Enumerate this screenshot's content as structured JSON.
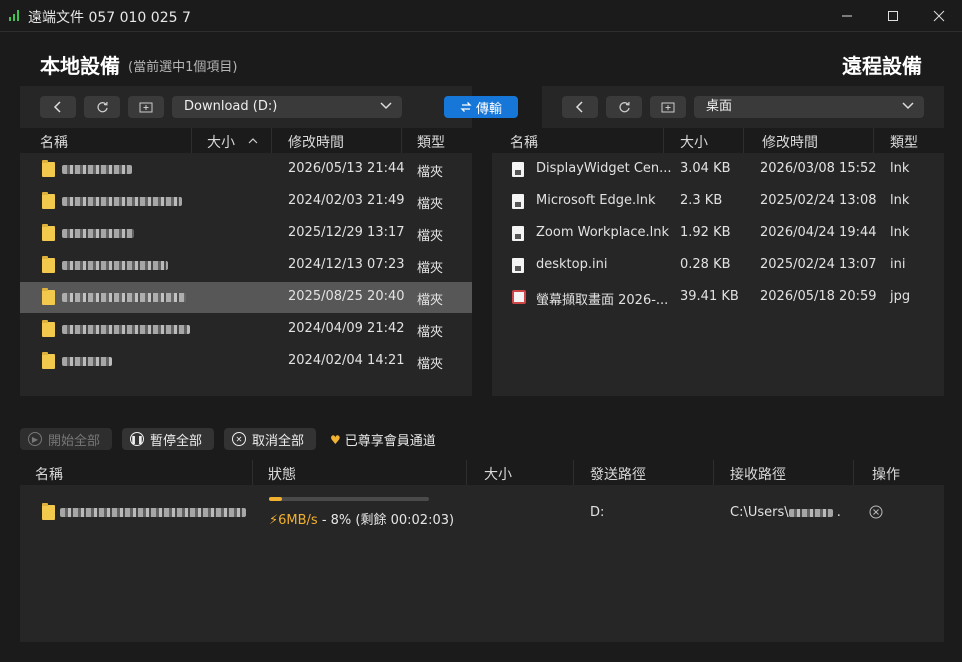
{
  "window": {
    "title": "遠端文件 057 010 025 7",
    "min_icon": "minimize-icon",
    "max_icon": "maximize-icon",
    "close_icon": "close-icon"
  },
  "local": {
    "title": "本地設備",
    "subtitle": "(當前選中1個項目)",
    "drive": "Download (D:)",
    "columns": [
      "名稱",
      "大小",
      "修改時間",
      "類型"
    ],
    "rows": [
      {
        "name": "",
        "size": "",
        "modified": "2026/05/13 21:44",
        "type": "檔夾",
        "blur_w": 70
      },
      {
        "name": "",
        "size": "",
        "modified": "2024/02/03 21:49",
        "type": "檔夾",
        "blur_w": 120
      },
      {
        "name": "",
        "size": "",
        "modified": "2025/12/29 13:17",
        "type": "檔夾",
        "blur_w": 72
      },
      {
        "name": "",
        "size": "",
        "modified": "2024/12/13 07:23",
        "type": "檔夾",
        "blur_w": 106
      },
      {
        "name": "",
        "size": "",
        "modified": "2025/08/25 20:40",
        "type": "檔夾",
        "blur_w": 124
      },
      {
        "name": "",
        "size": "",
        "modified": "2024/04/09 21:42",
        "type": "檔夾",
        "blur_w": 128
      },
      {
        "name": "",
        "size": "",
        "modified": "2024/02/04 14:21",
        "type": "檔夾",
        "blur_w": 50
      }
    ],
    "selected_index": 4,
    "sort_icon": "sort-ascending-icon"
  },
  "transfer_button": "傳輸",
  "remote": {
    "title": "遠程設備",
    "folder": "桌面",
    "columns": [
      "名稱",
      "大小",
      "修改時間",
      "類型"
    ],
    "rows": [
      {
        "name": "DisplayWidget Cen...",
        "size": "3.04 KB",
        "modified": "2026/03/08 15:52",
        "type": "lnk",
        "icon": "shortcut-file-icon"
      },
      {
        "name": "Microsoft Edge.lnk",
        "size": "2.3 KB",
        "modified": "2025/02/24 13:08",
        "type": "lnk",
        "icon": "shortcut-file-icon"
      },
      {
        "name": "Zoom Workplace.lnk",
        "size": "1.92 KB",
        "modified": "2026/04/24 19:44",
        "type": "lnk",
        "icon": "shortcut-file-icon"
      },
      {
        "name": "desktop.ini",
        "size": "0.28 KB",
        "modified": "2025/02/24 13:07",
        "type": "ini",
        "icon": "settings-file-icon"
      },
      {
        "name": "螢幕擷取畫面 2026-...",
        "size": "39.41 KB",
        "modified": "2026/05/18 20:59",
        "type": "jpg",
        "icon": "image-file-icon"
      }
    ]
  },
  "actions": {
    "start_all": "開始全部",
    "pause_all": "暫停全部",
    "cancel_all": "取消全部",
    "vip": "已尊享會員通道"
  },
  "queue": {
    "columns": [
      "名稱",
      "狀態",
      "大小",
      "發送路徑",
      "接收路徑",
      "操作"
    ],
    "items": [
      {
        "name": "",
        "progress": 0.08,
        "speed": "6MB/s",
        "status_rest": " - 8% (剩餘 00:02:03)",
        "size": "",
        "send_path": "D:",
        "recv_path": "C:\\Users\\"
      }
    ]
  },
  "colors": {
    "accent": "#1677d9",
    "progress": "#f0b030",
    "folder": "#f2c94c",
    "selected": "#575757"
  }
}
